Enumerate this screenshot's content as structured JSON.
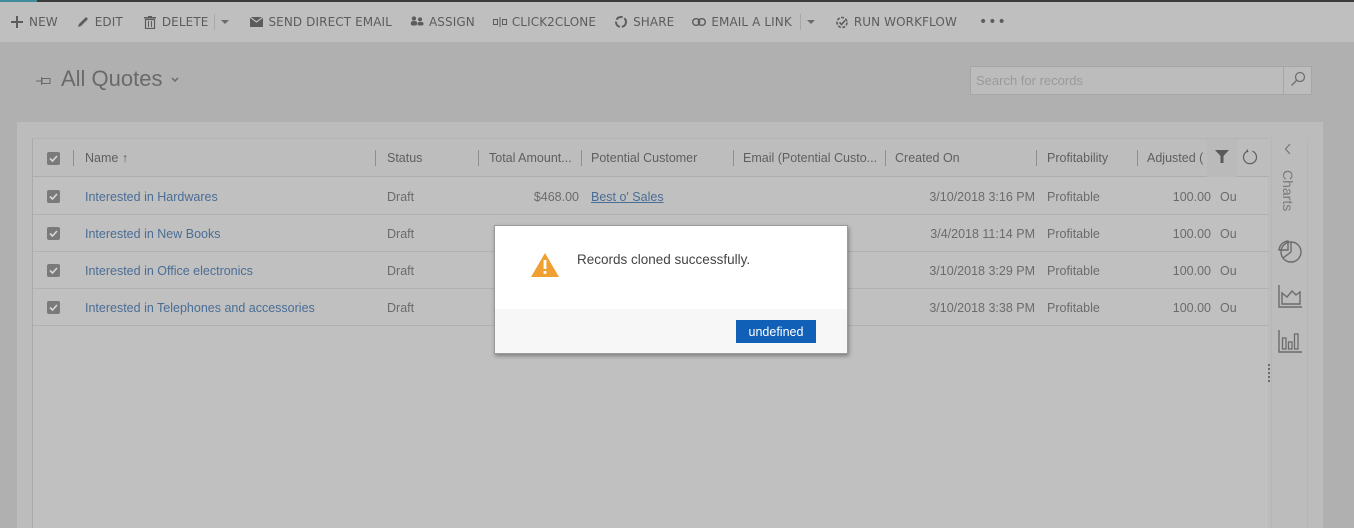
{
  "colors": {
    "accent_strip": "#3f8d9a",
    "link": "#4a6d96",
    "warning": "#f0a030",
    "primary_button": "#1160b7"
  },
  "commandbar": {
    "items": [
      {
        "label": "NEW",
        "icon": "plus-icon"
      },
      {
        "label": "EDIT",
        "icon": "pencil-icon"
      },
      {
        "label": "DELETE",
        "icon": "trash-icon"
      },
      {
        "label": "SEND DIRECT EMAIL",
        "icon": "envelope-icon"
      },
      {
        "label": "ASSIGN",
        "icon": "people-icon"
      },
      {
        "label": "CLICK2CLONE",
        "icon": "clone-icon"
      },
      {
        "label": "SHARE",
        "icon": "share-icon"
      },
      {
        "label": "EMAIL A LINK",
        "icon": "link-icon"
      },
      {
        "label": "RUN WORKFLOW",
        "icon": "workflow-icon"
      }
    ],
    "more_label": "•••"
  },
  "view": {
    "title": "All Quotes",
    "pin_icon": "pin-icon",
    "search_placeholder": "Search for records"
  },
  "grid": {
    "columns": [
      "Name ↑",
      "Status",
      "Total Amount...",
      "Potential Customer",
      "Email (Potential Custo...",
      "Created On",
      "Profitability",
      "Adjusted ("
    ],
    "rows": [
      {
        "name": "Interested in Hardwares",
        "status": "Draft",
        "total": "$468.00",
        "customer": "Best o' Sales",
        "email": "",
        "created": "3/10/2018 3:16 PM",
        "profit": "Profitable",
        "adjusted": "100.00",
        "next": "Ou",
        "checked": true
      },
      {
        "name": "Interested in New Books",
        "status": "Draft",
        "total": "",
        "customer": "",
        "email": "",
        "created": "3/4/2018 11:14 PM",
        "profit": "Profitable",
        "adjusted": "100.00",
        "next": "Ou",
        "checked": true
      },
      {
        "name": "Interested in Office electronics",
        "status": "Draft",
        "total": "",
        "customer": "",
        "email": "",
        "created": "3/10/2018 3:29 PM",
        "profit": "Profitable",
        "adjusted": "100.00",
        "next": "Ou",
        "checked": true
      },
      {
        "name": "Interested in Telephones and accessories",
        "status": "Draft",
        "total": "",
        "customer": "",
        "email": "",
        "created": "3/10/2018 3:38 PM",
        "profit": "Profitable",
        "adjusted": "100.00",
        "next": "Ou",
        "checked": true
      }
    ]
  },
  "charts_rail": {
    "label": "Charts"
  },
  "dialog": {
    "message": "Records cloned successfully.",
    "button_label": "undefined"
  }
}
